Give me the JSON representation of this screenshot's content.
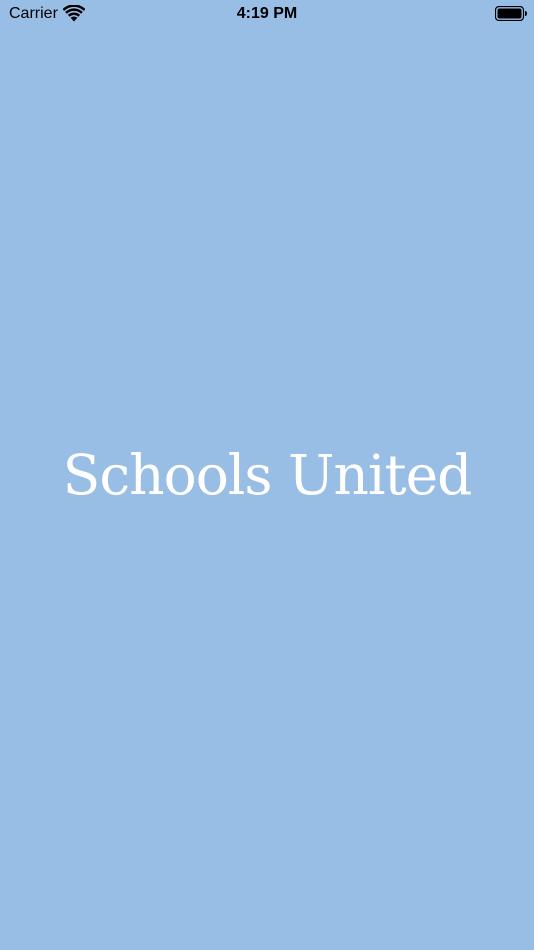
{
  "status_bar": {
    "carrier": "Carrier",
    "time": "4:19 PM",
    "wifi_icon": "wifi-icon",
    "battery_icon": "battery-icon"
  },
  "splash": {
    "brand": "Schools United",
    "background_color": "#99bee6",
    "text_color": "#ffffff"
  }
}
